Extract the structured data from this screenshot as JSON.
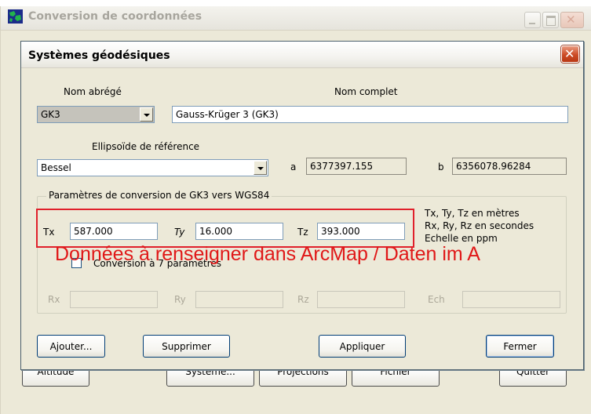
{
  "parent_window": {
    "title": "Conversion de coordonnées",
    "icon": "globe-map-icon",
    "background_buttons": [
      "Altitude",
      "Systeme...",
      "Projections",
      "Fichier",
      "Quitter"
    ]
  },
  "dialog": {
    "title": "Systèmes géodésiques",
    "close_icon": "close-icon",
    "short_name_label": "Nom abrégé",
    "short_name_value": "GK3",
    "full_name_label": "Nom complet",
    "full_name_value": "Gauss-Krüger 3 (GK3)",
    "ellipsoid_label": "Ellipsoïde de référence",
    "ellipsoid_value": "Bessel",
    "a_label": "a",
    "a_value": "6377397.155",
    "b_label": "b",
    "b_value": "6356078.96284",
    "params_group_label": "Paramètres de conversion de GK3 vers WGS84",
    "tx_label": "Tx",
    "tx_value": "587.000",
    "ty_label": "Ty",
    "ty_value": "16.000",
    "tz_label": "Tz",
    "tz_value": "393.000",
    "units_note": [
      "Tx, Ty, Tz en mètres",
      "Rx, Ry, Rz en secondes",
      "Echelle en ppm"
    ],
    "seven_params_label": "Conversion à 7 paramètres",
    "seven_params_checked": false,
    "rx_label": "Rx",
    "ry_label": "Ry",
    "rz_label": "Rz",
    "scale_label": "Ech",
    "buttons": {
      "add": "Ajouter...",
      "delete": "Supprimer",
      "apply": "Appliquer",
      "close": "Fermer"
    }
  },
  "overlay_annotation": "Données à renseigner dans ArcMap / Daten im A",
  "colors": {
    "window_bg": "#ece9d8",
    "annotation_red": "#e01818",
    "highlight_border": "#e0202b",
    "field_border": "#7f9db9",
    "button_border": "#003c74"
  }
}
